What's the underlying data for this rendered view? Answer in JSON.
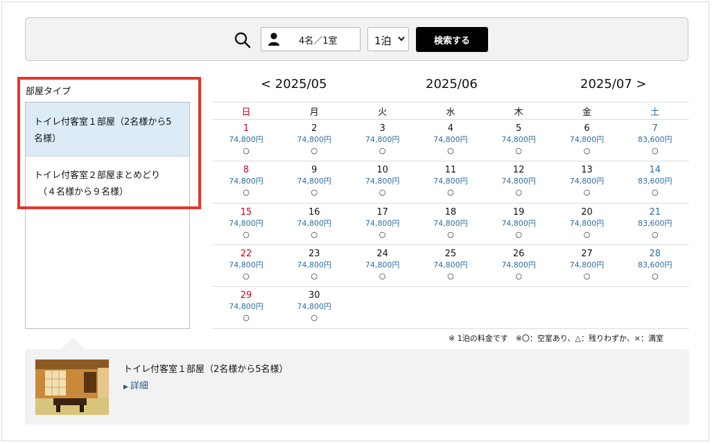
{
  "search": {
    "guests": "4名／1室",
    "nights": "1泊",
    "button_label": "検索する"
  },
  "room_types": {
    "title": "部屋タイプ",
    "items": [
      {
        "line1": "トイレ付客室１部屋（2名様から5",
        "line2": "名様）"
      },
      {
        "line1": "トイレ付客室２部屋まとめどり",
        "line2": "（４名様から９名様）"
      }
    ]
  },
  "calendar": {
    "prev": "< 2025/05",
    "current": "2025/06",
    "next": "2025/07 >",
    "weekdays": [
      "日",
      "月",
      "火",
      "水",
      "木",
      "金",
      "土"
    ],
    "weeks": [
      [
        {
          "d": "1",
          "p": "74,800円",
          "a": "○"
        },
        {
          "d": "2",
          "p": "74,800円",
          "a": "○"
        },
        {
          "d": "3",
          "p": "74,800円",
          "a": "○"
        },
        {
          "d": "4",
          "p": "74,800円",
          "a": "○"
        },
        {
          "d": "5",
          "p": "74,800円",
          "a": "○"
        },
        {
          "d": "6",
          "p": "74,800円",
          "a": "○"
        },
        {
          "d": "7",
          "p": "83,600円",
          "a": "○"
        }
      ],
      [
        {
          "d": "8",
          "p": "74,800円",
          "a": "○"
        },
        {
          "d": "9",
          "p": "74,800円",
          "a": "○"
        },
        {
          "d": "10",
          "p": "74,800円",
          "a": "○"
        },
        {
          "d": "11",
          "p": "74,800円",
          "a": "○"
        },
        {
          "d": "12",
          "p": "74,800円",
          "a": "○"
        },
        {
          "d": "13",
          "p": "74,800円",
          "a": "○"
        },
        {
          "d": "14",
          "p": "83,600円",
          "a": "○"
        }
      ],
      [
        {
          "d": "15",
          "p": "74,800円",
          "a": "○"
        },
        {
          "d": "16",
          "p": "74,800円",
          "a": "○"
        },
        {
          "d": "17",
          "p": "74,800円",
          "a": "○"
        },
        {
          "d": "18",
          "p": "74,800円",
          "a": "○"
        },
        {
          "d": "19",
          "p": "74,800円",
          "a": "○"
        },
        {
          "d": "20",
          "p": "74,800円",
          "a": "○"
        },
        {
          "d": "21",
          "p": "83,600円",
          "a": "○"
        }
      ],
      [
        {
          "d": "22",
          "p": "74,800円",
          "a": "○"
        },
        {
          "d": "23",
          "p": "74,800円",
          "a": "○"
        },
        {
          "d": "24",
          "p": "74,800円",
          "a": "○"
        },
        {
          "d": "25",
          "p": "74,800円",
          "a": "○"
        },
        {
          "d": "26",
          "p": "74,800円",
          "a": "○"
        },
        {
          "d": "27",
          "p": "74,800円",
          "a": "○"
        },
        {
          "d": "28",
          "p": "83,600円",
          "a": "○"
        }
      ],
      [
        {
          "d": "29",
          "p": "74,800円",
          "a": "○"
        },
        {
          "d": "30",
          "p": "74,800円",
          "a": "○"
        }
      ]
    ],
    "note": "※ 1泊の料金です　※〇：空室あり、△：残りわずか、×：満室"
  },
  "detail": {
    "title": "トイレ付客室１部屋（2名様から5名様）",
    "link": "詳細"
  },
  "colors": {
    "sunday": "#d0021b",
    "saturday": "#2d6ea3",
    "price": "#2d6ea3",
    "highlight": "#e8342a",
    "selected_bg": "#dcebf6"
  }
}
